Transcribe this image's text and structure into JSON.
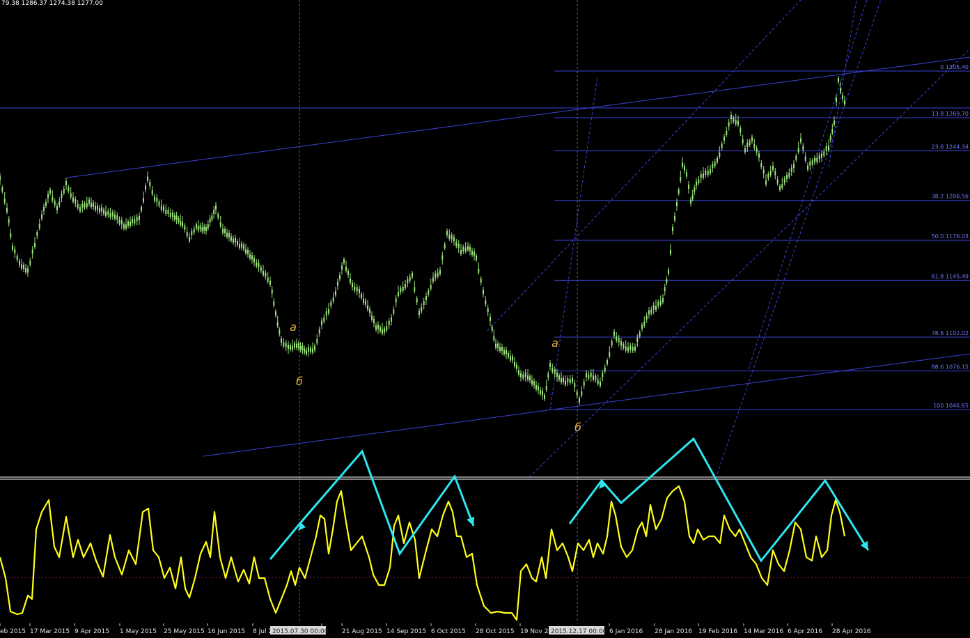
{
  "window": {
    "ohlc_header": "79.38 1286.37 1274.38 1277.00"
  },
  "colors": {
    "background": "#000000",
    "candle": "#9be57a",
    "fib_line": "#3a44d8",
    "channel_line": "#3a44d8",
    "oscillator": "#ffff1a",
    "arrow": "#2ee6f0",
    "wave_label": "#e8b23a",
    "separator": "#ffffff",
    "zero_level": "#8a1a6a"
  },
  "fibonacci": {
    "levels": [
      {
        "text": "0 1305.40",
        "price": 1305.4
      },
      {
        "text": "13.8 1269.70",
        "price": 1269.7
      },
      {
        "text": "23.6 1244.34",
        "price": 1244.34
      },
      {
        "text": "38.2 1206.56",
        "price": 1206.56
      },
      {
        "text": "50.0 1176.03",
        "price": 1176.03
      },
      {
        "text": "61.8 1145.49",
        "price": 1145.49
      },
      {
        "text": "78.6 1102.02",
        "price": 1102.02
      },
      {
        "text": "88.6 1076.15",
        "price": 1076.15
      },
      {
        "text": "100 1046.65",
        "price": 1046.65
      }
    ]
  },
  "wave_labels": [
    {
      "text": "a",
      "date_index": 1
    },
    {
      "text": "б",
      "date_index": 1
    },
    {
      "text": "a",
      "date_index": 2
    },
    {
      "text": "б",
      "date_index": 2
    }
  ],
  "time_axis": {
    "labels": [
      "eb 2015",
      "17 Mar 2015",
      "9 Apr 2015",
      "1 May 2015",
      "25 May 2015",
      "16 Jun 2015",
      "8 Jul 2",
      "5",
      "21 Aug 2015",
      "14 Sep 2015",
      "6 Oct 2015",
      "28 Oct 2015",
      "19 Nov 2",
      "6 Jan 2016",
      "28 Jan 2016",
      "19 Feb 2016",
      "14 Mar 2016",
      "6 Apr 2016",
      "28 Apr 2016"
    ],
    "crosshair_labels": [
      "2015.07.30 00:00",
      "2015.12.17 00:00"
    ]
  }
}
